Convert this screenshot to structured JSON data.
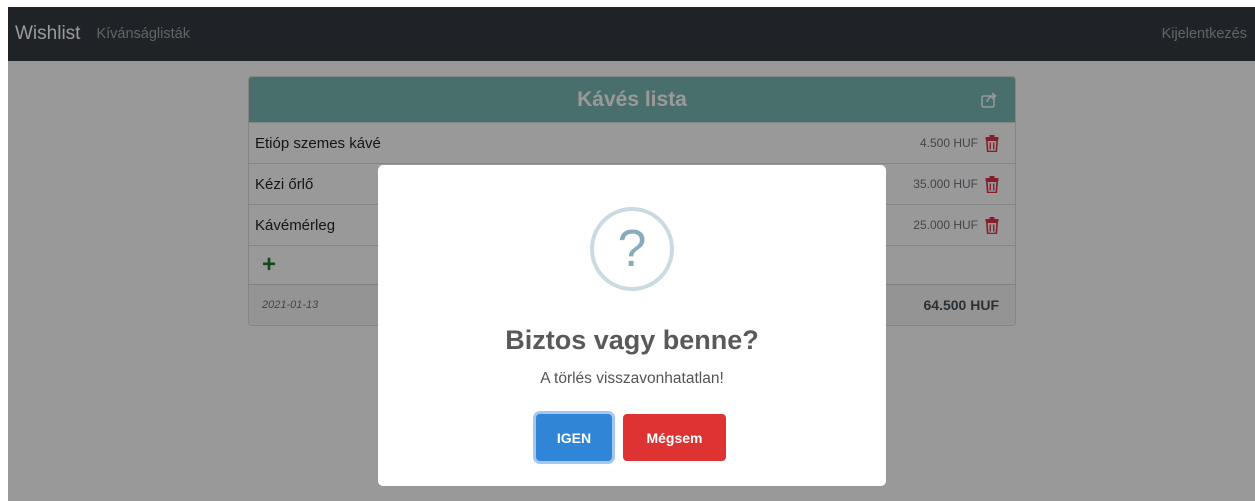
{
  "navbar": {
    "brand": "Wishlist",
    "links": [
      "Kívánságlisták"
    ],
    "logout": "Kijelentkezés"
  },
  "list": {
    "title": "Kávés lista",
    "header_color": "#79b9b3",
    "items": [
      {
        "name": "Etióp szemes kávé",
        "price": "4.500 HUF"
      },
      {
        "name": "Kézi őrlő",
        "price": "35.000 HUF"
      },
      {
        "name": "Kávémérleg",
        "price": "25.000 HUF"
      }
    ],
    "add_symbol": "+",
    "date": "2021-01-13",
    "total": "64.500 HUF"
  },
  "dialog": {
    "icon": "question-icon",
    "icon_glyph": "?",
    "title": "Biztos vagy benne?",
    "text": "A törlés visszavonhatatlan!",
    "confirm_label": "IGEN",
    "cancel_label": "Mégsem",
    "confirm_color": "#3085d6",
    "cancel_color": "#dd3333"
  },
  "icons": {
    "share": "share-icon",
    "delete": "trash-icon",
    "add": "plus-icon"
  }
}
